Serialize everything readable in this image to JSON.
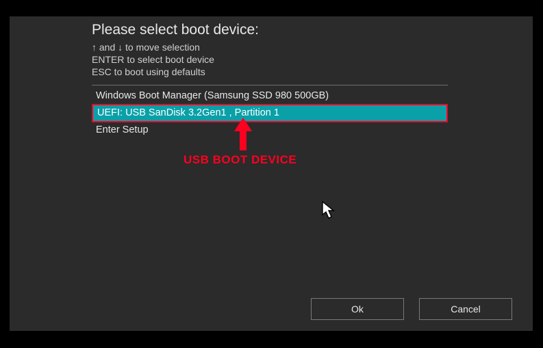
{
  "title": "Please select boot device:",
  "instructions": {
    "line1": "↑ and ↓ to move selection",
    "line2": "ENTER to select boot device",
    "line3": "ESC to boot using defaults"
  },
  "devices": {
    "item0": "Windows Boot Manager (Samsung SSD 980 500GB)",
    "item1": "UEFI: USB SanDisk 3.2Gen1 , Partition 1",
    "item2": "Enter Setup"
  },
  "annotation": {
    "label": "USB BOOT DEVICE"
  },
  "buttons": {
    "ok": "Ok",
    "cancel": "Cancel"
  }
}
